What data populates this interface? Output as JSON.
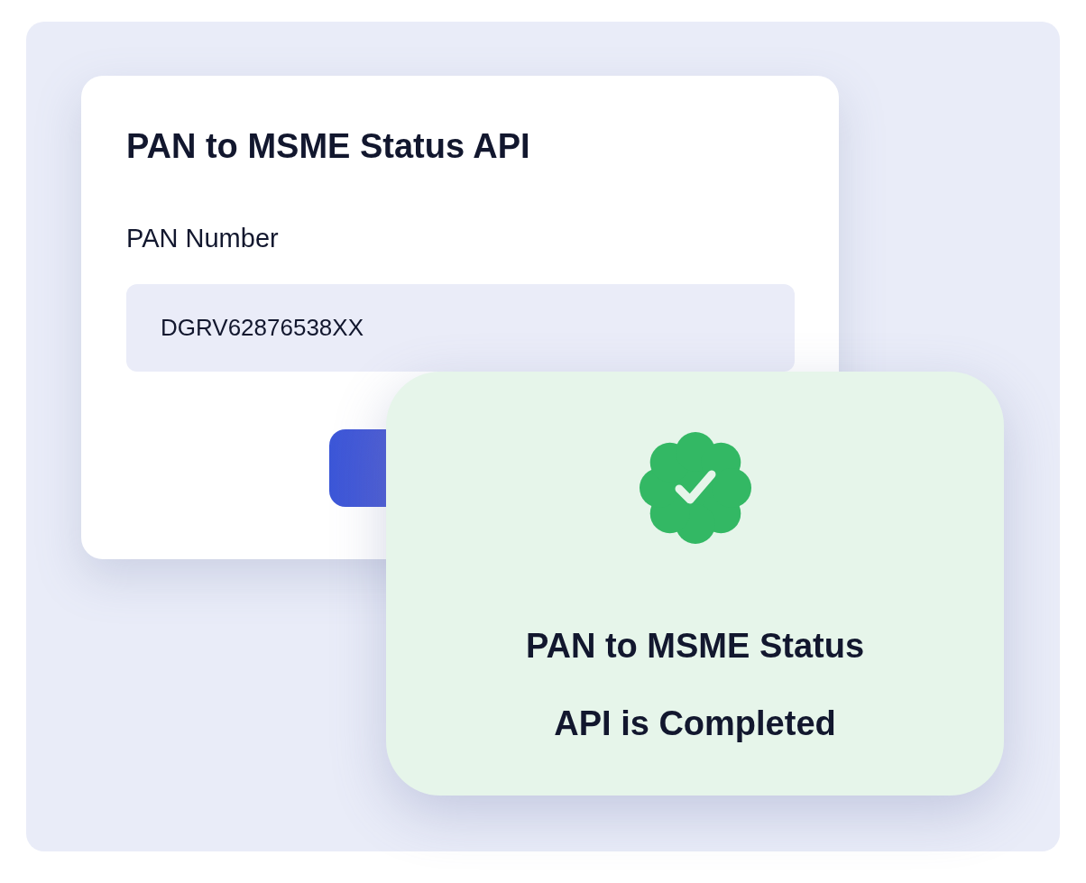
{
  "form_card": {
    "title": "PAN to MSME Status API",
    "field": {
      "label": "PAN Number",
      "value": "DGRV62876538XX"
    }
  },
  "success_card": {
    "message": "PAN to MSME Status API is Completed"
  }
}
